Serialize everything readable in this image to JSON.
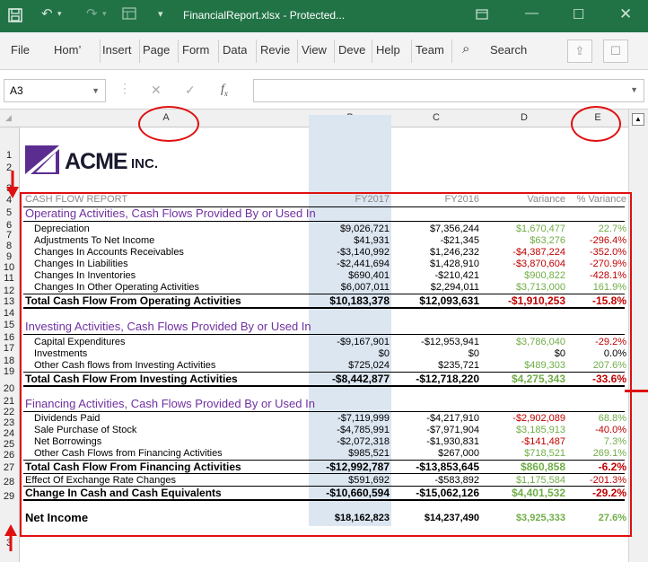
{
  "titlebar": {
    "title": "FinancialReport.xlsx - Protected...",
    "icons": [
      "save-icon",
      "undo-icon",
      "redo-icon",
      "layout-icon",
      "customize-icon",
      "ribbon-display-icon",
      "minimize-icon",
      "maximize-icon",
      "close-icon"
    ]
  },
  "ribbon": {
    "tabs": [
      "File",
      "Hom’",
      "Insert",
      "Page",
      "Form",
      "Data",
      "Revie",
      "View",
      "Deve",
      "Help",
      "Team"
    ],
    "search_label": "Search"
  },
  "formula_bar": {
    "name_box": "A3",
    "value": ""
  },
  "columns": [
    "A",
    "B",
    "C",
    "D",
    "E"
  ],
  "row_numbers": [
    "1",
    "2",
    "3",
    "4",
    "5",
    "6",
    "7",
    "8",
    "9",
    "10",
    "11",
    "12",
    "13",
    "14",
    "15",
    "16",
    "17",
    "18",
    "19",
    "20",
    "21",
    "22",
    "23",
    "24",
    "25",
    "26",
    "27",
    "28",
    "29",
    "3"
  ],
  "logo": {
    "text": "ACME",
    "suffix": "INC."
  },
  "report": {
    "header": {
      "label": "CASH FLOW REPORT",
      "fy2017": "FY2017",
      "fy2016": "FY2016",
      "variance": "Variance",
      "pct": "% Variance"
    },
    "operating": {
      "title": "Operating Activities, Cash Flows Provided By or Used In",
      "rows": [
        {
          "label": "Depreciation",
          "fy2017": "$9,026,721",
          "fy2016": "$7,356,244",
          "variance": "$1,670,477",
          "pct": "22.7%"
        },
        {
          "label": "Adjustments To Net Income",
          "fy2017": "$41,931",
          "fy2016": "-$21,345",
          "variance": "$63,276",
          "pct": "-296.4%"
        },
        {
          "label": "Changes In Accounts Receivables",
          "fy2017": "-$3,140,992",
          "fy2016": "$1,246,232",
          "variance": "-$4,387,224",
          "pct": "-352.0%"
        },
        {
          "label": "Changes In Liabilities",
          "fy2017": "-$2,441,694",
          "fy2016": "$1,428,910",
          "variance": "-$3,870,604",
          "pct": "-270.9%"
        },
        {
          "label": "Changes In Inventories",
          "fy2017": "$690,401",
          "fy2016": "-$210,421",
          "variance": "$900,822",
          "pct": "-428.1%"
        },
        {
          "label": "Changes In Other Operating Activities",
          "fy2017": "$6,007,011",
          "fy2016": "$2,294,011",
          "variance": "$3,713,000",
          "pct": "161.9%"
        }
      ],
      "total": {
        "label": "Total Cash Flow From Operating Activities",
        "fy2017": "$10,183,378",
        "fy2016": "$12,093,631",
        "variance": "-$1,910,253",
        "pct": "-15.8%"
      }
    },
    "investing": {
      "title": "Investing Activities, Cash Flows Provided By or Used In",
      "rows": [
        {
          "label": "Capital Expenditures",
          "fy2017": "-$9,167,901",
          "fy2016": "-$12,953,941",
          "variance": "$3,786,040",
          "pct": "-29.2%"
        },
        {
          "label": "Investments",
          "fy2017": "$0",
          "fy2016": "$0",
          "variance": "$0",
          "pct": "0.0%"
        },
        {
          "label": "Other Cash flows from Investing Activities",
          "fy2017": "$725,024",
          "fy2016": "$235,721",
          "variance": "$489,303",
          "pct": "207.6%"
        }
      ],
      "total": {
        "label": "Total Cash Flow From Investing Activities",
        "fy2017": "-$8,442,877",
        "fy2016": "-$12,718,220",
        "variance": "$4,275,343",
        "pct": "-33.6%"
      }
    },
    "financing": {
      "title": "Financing Activities, Cash Flows Provided By or Used In",
      "rows": [
        {
          "label": "Dividends Paid",
          "fy2017": "-$7,119,999",
          "fy2016": "-$4,217,910",
          "variance": "-$2,902,089",
          "pct": "68.8%"
        },
        {
          "label": "Sale Purchase of Stock",
          "fy2017": "-$4,785,991",
          "fy2016": "-$7,971,904",
          "variance": "$3,185,913",
          "pct": "-40.0%"
        },
        {
          "label": "Net Borrowings",
          "fy2017": "-$2,072,318",
          "fy2016": "-$1,930,831",
          "variance": "-$141,487",
          "pct": "7.3%"
        },
        {
          "label": "Other Cash Flows from Financing Activities",
          "fy2017": "$985,521",
          "fy2016": "$267,000",
          "variance": "$718,521",
          "pct": "269.1%"
        }
      ],
      "total": {
        "label": "Total Cash Flow From Financing Activities",
        "fy2017": "-$12,992,787",
        "fy2016": "-$13,853,645",
        "variance": "$860,858",
        "pct": "-6.2%"
      }
    },
    "exchange": {
      "label": "Effect Of Exchange Rate Changes",
      "fy2017": "$591,692",
      "fy2016": "-$583,892",
      "variance": "$1,175,584",
      "pct": "-201.3%"
    },
    "change": {
      "label": "Change In Cash and Cash Equivalents",
      "fy2017": "-$10,660,594",
      "fy2016": "-$15,062,126",
      "variance": "$4,401,532",
      "pct": "-29.2%"
    },
    "net_income": {
      "label": "Net Income",
      "fy2017": "$18,162,823",
      "fy2016": "$14,237,490",
      "variance": "$3,925,333",
      "pct": "27.6%"
    }
  },
  "colors": {
    "excel_green": "#217346",
    "purple": "#7030a0",
    "positive": "#70ad47",
    "negative": "#c00000",
    "annotation": "#e01010",
    "band": "#dce6f1"
  }
}
